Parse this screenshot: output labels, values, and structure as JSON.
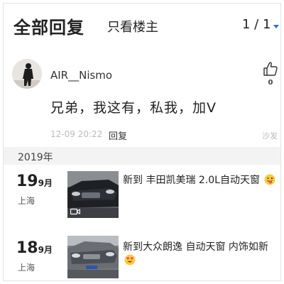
{
  "header": {
    "title": "全部回复",
    "only_host": "只看楼主",
    "pager": "1 / 1"
  },
  "comment": {
    "username": "AIR__Nismo",
    "like_count": "0",
    "text": "兄弟，我这有，私我，加V",
    "time": "12-09 20:22",
    "reply_label": "回复",
    "sofa_label": "沙发"
  },
  "timeline": {
    "year": "2019年",
    "posts": [
      {
        "day": "19",
        "month": "9月",
        "city": "上海",
        "title": "新到 丰田凯美瑞 2.0L自动天窗",
        "emoji": "tongue-face-emoji",
        "has_video": true
      },
      {
        "day": "18",
        "month": "9月",
        "city": "上海",
        "title": "新到大众朗逸 自动天窗 内饰如新",
        "emoji": "heart-eyes-emoji",
        "has_video": false
      }
    ]
  },
  "colors": {
    "accent": "#2a6fdb",
    "muted_text": "#bbbbbb",
    "section_bg": "#f3f3f3"
  }
}
